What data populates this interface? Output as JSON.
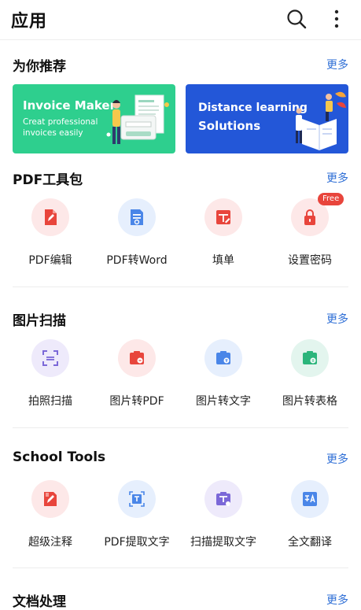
{
  "app": {
    "title": "应用"
  },
  "recommend": {
    "title": "为你推荐",
    "more": "更多",
    "banners": [
      {
        "title": "Invoice Maker",
        "subtitle": "Creat professional invoices easily",
        "color": "#2ecf8e"
      },
      {
        "title": "Distance learning",
        "subtitle": "Solutions",
        "color": "#2357d8"
      }
    ]
  },
  "pdf_tools": {
    "title": "PDF工具包",
    "more": "更多",
    "items": [
      {
        "label": "PDF编辑",
        "icon": "pdf-edit-icon"
      },
      {
        "label": "PDF转Word",
        "icon": "pdf-to-word-icon"
      },
      {
        "label": "填单",
        "icon": "fill-form-icon"
      },
      {
        "label": "设置密码",
        "icon": "lock-icon",
        "badge": "Free"
      }
    ]
  },
  "scan": {
    "title": "图片扫描",
    "more": "更多",
    "items": [
      {
        "label": "拍照扫描",
        "icon": "scan-icon"
      },
      {
        "label": "图片转PDF",
        "icon": "image-to-pdf-icon"
      },
      {
        "label": "图片转文字",
        "icon": "image-to-text-icon"
      },
      {
        "label": "图片转表格",
        "icon": "image-to-table-icon"
      }
    ]
  },
  "school": {
    "title": "School Tools",
    "more": "更多",
    "items": [
      {
        "label": "超级注释",
        "icon": "annotate-icon"
      },
      {
        "label": "PDF提取文字",
        "icon": "pdf-extract-text-icon"
      },
      {
        "label": "扫描提取文字",
        "icon": "scan-extract-text-icon"
      },
      {
        "label": "全文翻译",
        "icon": "translate-icon"
      }
    ]
  },
  "docs": {
    "title": "文档处理",
    "more": "更多"
  },
  "colors": {
    "accent": "#2f6fd6",
    "red": "#e8453c",
    "blue": "#4a86e8",
    "purple": "#7b68d8",
    "green": "#2bb57b"
  }
}
